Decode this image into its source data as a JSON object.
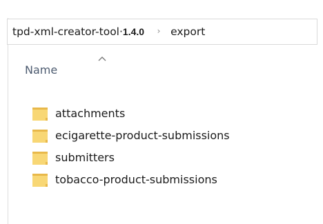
{
  "breadcrumb": {
    "root_text": "tpd-xml-creator-tool·",
    "root_version": "1.4.0",
    "separator": "›",
    "current": "export"
  },
  "column_header": {
    "label": "Name",
    "sort_icon": "sort-up-chevron-icon"
  },
  "items": [
    {
      "label": "attachments",
      "icon": "folder-icon"
    },
    {
      "label": "ecigarette-product-submissions",
      "icon": "folder-icon"
    },
    {
      "label": "submitters",
      "icon": "folder-icon"
    },
    {
      "label": "tobacco-product-submissions",
      "icon": "folder-icon"
    }
  ],
  "colors": {
    "folder_fill": "#F8D775",
    "folder_shade": "#E8B84A",
    "header_text": "#4D5B70"
  }
}
